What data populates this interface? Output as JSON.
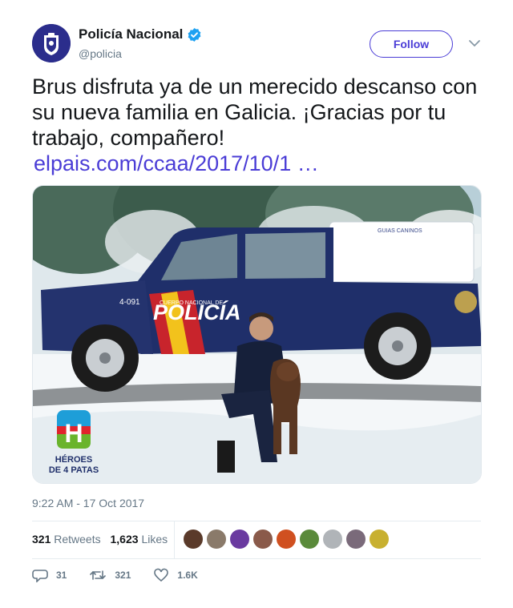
{
  "author": {
    "name": "Policía Nacional",
    "handle": "@policia",
    "verified": true,
    "avatar_icon": "police-crest-icon"
  },
  "follow_label": "Follow",
  "tweet": {
    "text": "Brus disfruta ya de un merecido descanso con su nueva familia en Galicia. ¡Gracias por tu trabajo, compañero!",
    "link": "elpais.com/ccaa/2017/10/1 …"
  },
  "media": {
    "vehicle_label": "POLICÍA",
    "vehicle_sub_label": "CUERPO NACIONAL DE",
    "canopy_label": "GUIAS CANINOS",
    "plate": "4-091",
    "logo_letter": "H",
    "logo_line1": "HÉROES",
    "logo_line2": "DE 4 PATAS"
  },
  "timestamp": "9:22 AM - 17 Oct 2017",
  "stats": {
    "retweets_count": "321",
    "retweets_label": "Retweets",
    "likes_count": "1,623",
    "likes_label": "Likes"
  },
  "liker_colors": [
    "#5a3a2a",
    "#8a7a6a",
    "#6a3aa0",
    "#8a5a4a",
    "#d05020",
    "#5a8a3a",
    "#b0b4b8",
    "#7a6a7a",
    "#c8b030"
  ],
  "actions": {
    "replies": "31",
    "retweets": "321",
    "likes": "1.6K"
  },
  "colors": {
    "accent": "#4a3cd6",
    "verified": "#1da1f2",
    "muted": "#657786"
  }
}
